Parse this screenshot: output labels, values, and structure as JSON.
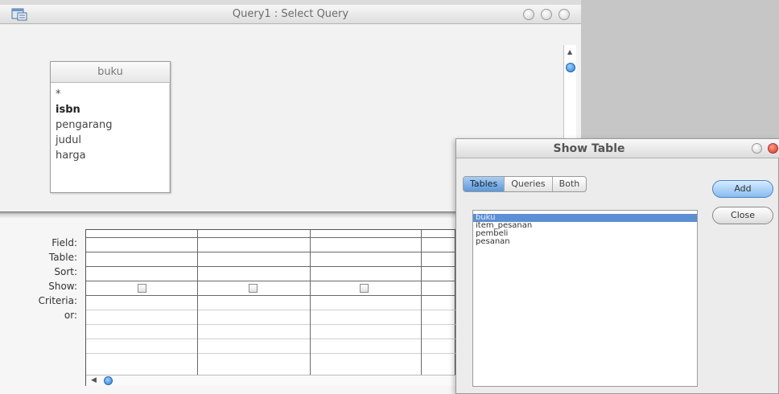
{
  "query_window": {
    "title": "Query1 : Select Query"
  },
  "table_box": {
    "name": "buku",
    "fields": [
      "*",
      "isbn",
      "pengarang",
      "judul",
      "harga"
    ],
    "primary_key_field": "isbn"
  },
  "design_grid": {
    "row_labels": [
      "Field:",
      "Table:",
      "Sort:",
      "Show:",
      "Criteria:",
      "or:"
    ],
    "columns_visible": 4
  },
  "show_table": {
    "title": "Show Table",
    "tabs": [
      "Tables",
      "Queries",
      "Both"
    ],
    "active_tab": "Tables",
    "tables": [
      "buku",
      "item_pesanan",
      "pembeli",
      "pesanan"
    ],
    "selected_table": "buku",
    "buttons": {
      "add": "Add",
      "close": "Close"
    }
  },
  "colors": {
    "selection": "#5c8fd3",
    "scroll_thumb": "#2a7fd6",
    "close_button": "#d3321c"
  }
}
